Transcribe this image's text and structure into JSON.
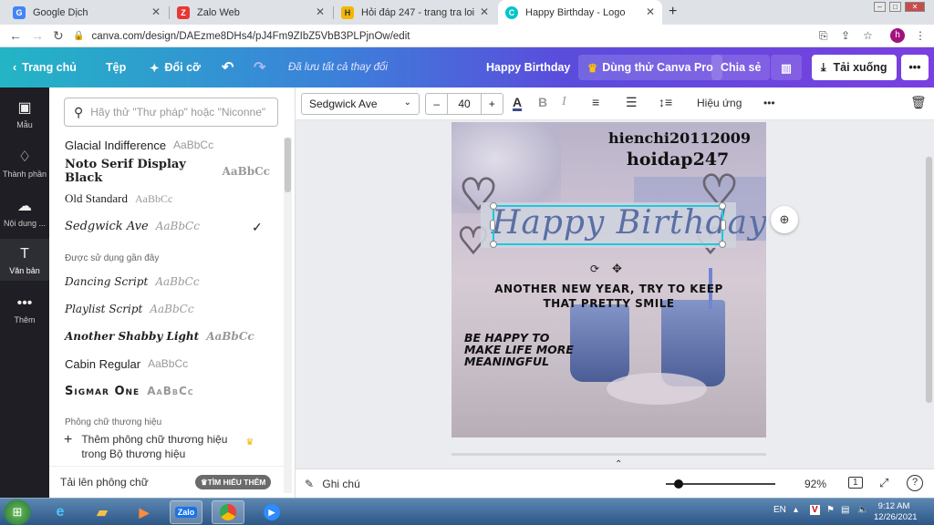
{
  "browser": {
    "tabs": [
      {
        "title": "Google Dịch",
        "favicon": "google-translate-icon"
      },
      {
        "title": "Zalo Web",
        "favicon": "zalo-icon"
      },
      {
        "title": "Hỏi đáp 247 - trang tra loi",
        "favicon": "hoidap247-icon"
      },
      {
        "title": "Happy Birthday - Logo",
        "favicon": "canva-icon"
      }
    ],
    "new_tab": "+",
    "url": "canva.com/design/DAEzme8DHs4/pJ4Fm9ZIbZ5VbB3PLPjnOw/edit",
    "profile_initial": "h"
  },
  "canva": {
    "topbar": {
      "home": "Trang chủ",
      "file": "Tệp",
      "resize": "Đổi cỡ",
      "saved": "Đã lưu tất cả thay đổi",
      "design_title": "Happy Birthday",
      "try_pro": "Dùng thử Canva Pro",
      "share": "Chia sẻ",
      "download": "Tải xuống",
      "more": "•••"
    },
    "rail": [
      {
        "label": "Mẫu",
        "icon": "template-icon"
      },
      {
        "label": "Thành phần",
        "icon": "elements-icon"
      },
      {
        "label": "Nội dung ...",
        "icon": "upload-icon"
      },
      {
        "label": "Văn bản",
        "icon": "text-icon"
      },
      {
        "label": "Thêm",
        "icon": "more-icon"
      }
    ],
    "font_panel": {
      "search_placeholder": "Hãy thử \"Thư pháp\" hoặc \"Niconne\"",
      "fonts": [
        {
          "name": "Glacial Indifference",
          "preview": "AaBbCc"
        },
        {
          "name": "Noto Serif Display Black",
          "preview": "AaBbCc"
        },
        {
          "name": "Old Standard",
          "preview": "AaBbCc"
        },
        {
          "name": "Sedgwick Ave",
          "preview": "AaBbCc"
        }
      ],
      "recent_heading": "Được sử dụng gần đây",
      "recent": [
        {
          "name": "Dancing Script",
          "preview": "AaBbCc"
        },
        {
          "name": "Playlist Script",
          "preview": "AaBbCc"
        },
        {
          "name": "Another Shabby Light",
          "preview": "AaBbCc"
        },
        {
          "name": "Cabin Regular",
          "preview": "AaBbCc"
        },
        {
          "name": "Sigmar One",
          "preview": "AaBbCc"
        }
      ],
      "brand_heading": "Phông chữ thương hiệu",
      "brand_add": "Thêm phông chữ thương hiệu trong Bộ thương hiệu",
      "upload": "Tải lên phông chữ",
      "learn_more": "TÌM HIỂU THÊM"
    },
    "toolbar": {
      "font": "Sedgwick Ave",
      "size": "40",
      "minus": "–",
      "plus": "+",
      "effects": "Hiệu ứng",
      "more": "•••"
    },
    "design": {
      "line1": "hienchi20112009",
      "line2": "hoidap247",
      "headline": "Happy Birthday",
      "subtitle1": "ANOTHER NEW YEAR, TRY TO KEEP",
      "subtitle2": "THAT PRETTY SMILE",
      "body1": "BE HAPPY TO",
      "body2": "MAKE LIFE MORE",
      "body3": "MEANINGFUL"
    },
    "bottombar": {
      "notes": "Ghi chú",
      "zoom": "92%",
      "page": "1",
      "help": "?",
      "zoom_level": 0.12
    }
  },
  "taskbar": {
    "lang": "EN",
    "time": "9:12 AM",
    "date": "12/26/2021"
  },
  "colors": {
    "accent_gradient_start": "#23b5c5",
    "accent_gradient_end": "#7a3fe0",
    "selection": "#1ec8e0",
    "headline": "#5a6fa3"
  }
}
